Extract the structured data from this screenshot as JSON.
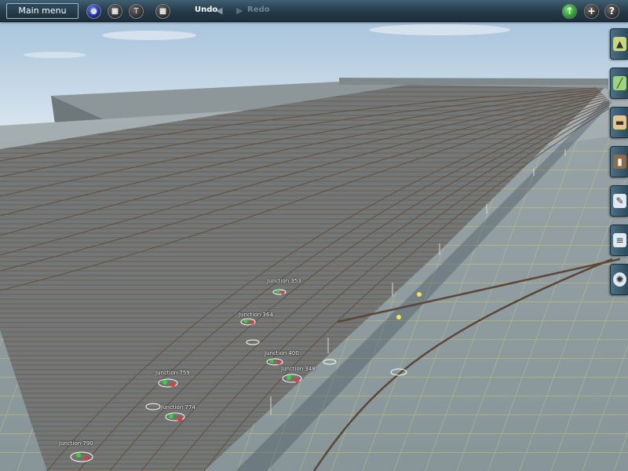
{
  "toolbar": {
    "main_menu_label": "Main menu",
    "undo_label": "Undo",
    "redo_label": "Redo",
    "left_icons": [
      "globe-icon",
      "stop-icon",
      "signal-icon",
      "stop-square-icon"
    ],
    "right_icons": [
      "up-arrow-icon",
      "plus-icon",
      "help-icon"
    ]
  },
  "side_tabs": [
    {
      "name": "terrain-tab",
      "icon": "landscape-icon"
    },
    {
      "name": "track-tab",
      "icon": "track-icon"
    },
    {
      "name": "objects-tab",
      "icon": "building-icon"
    },
    {
      "name": "rolling-stock-tab",
      "icon": "train-icon"
    },
    {
      "name": "tools-tab",
      "icon": "wrench-icon"
    },
    {
      "name": "layers-tab",
      "icon": "layers-icon"
    },
    {
      "name": "settings-tab",
      "icon": "gear-icon"
    }
  ],
  "junctions": {
    "j759": "Junction 759",
    "j774": "Junction 774",
    "j790": "Junction 790",
    "j348": "Junction 348",
    "j400": "Junction 400",
    "j364": "Junction 364",
    "j353": "Junction 353"
  },
  "colors": {
    "toolbar": "#243a48",
    "grid_line": "#f0e878",
    "ground": "#8c9aa0",
    "track": "#6b5a4c",
    "sky_top": "#9fb6cc"
  }
}
